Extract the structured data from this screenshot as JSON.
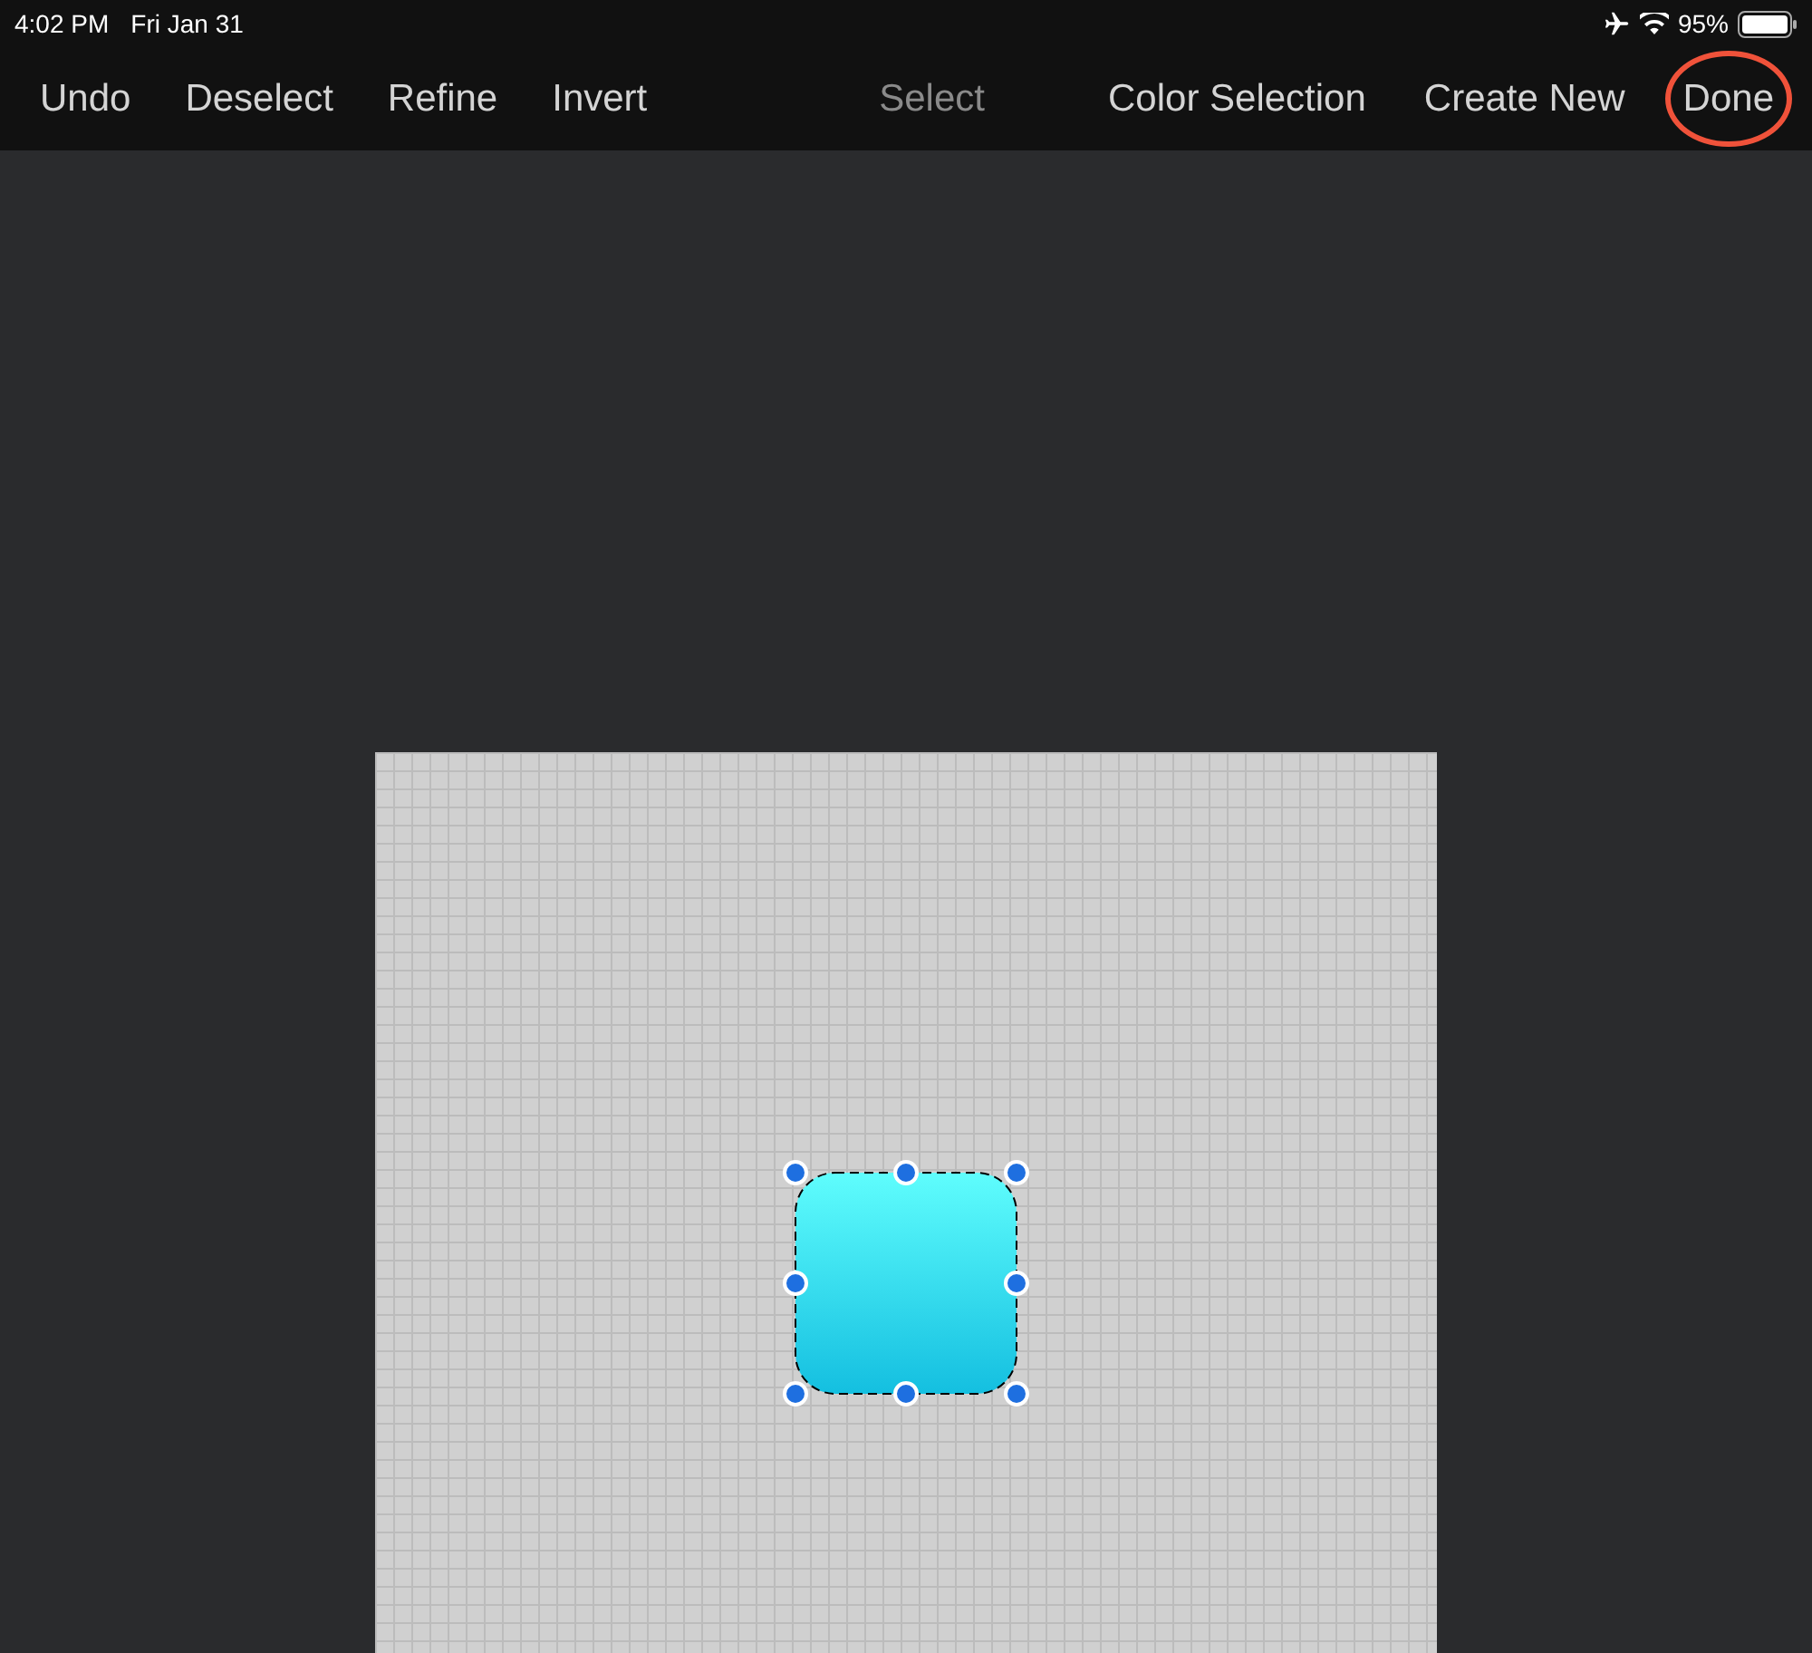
{
  "status_bar": {
    "time": "4:02 PM",
    "date": "Fri Jan 31",
    "battery": "95%"
  },
  "toolbar": {
    "left_items": [
      {
        "label": "Undo"
      },
      {
        "label": "Deselect"
      },
      {
        "label": "Refine"
      },
      {
        "label": "Invert"
      }
    ],
    "title": "Select",
    "right_items": [
      {
        "label": "Color Selection",
        "highlighted": false
      },
      {
        "label": "Create New",
        "highlighted": false
      },
      {
        "label": "Done",
        "highlighted": true
      }
    ]
  }
}
